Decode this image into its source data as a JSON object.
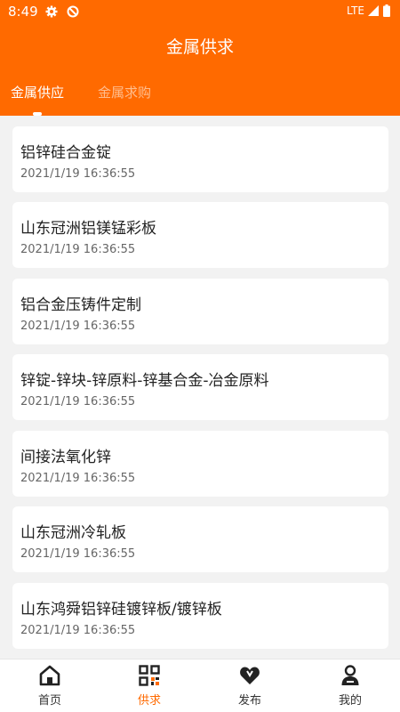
{
  "status_bar": {
    "time": "8:49",
    "network": "LTE"
  },
  "header": {
    "title": "金属供求"
  },
  "tabs": [
    {
      "label": "金属供应",
      "active": true
    },
    {
      "label": "金属求购",
      "active": false
    }
  ],
  "items": [
    {
      "title": "铝锌硅合金锭",
      "date": "2021/1/19 16:36:55"
    },
    {
      "title": "山东冠洲铝镁锰彩板",
      "date": "2021/1/19 16:36:55"
    },
    {
      "title": "铝合金压铸件定制",
      "date": "2021/1/19 16:36:55"
    },
    {
      "title": "锌锭-锌块-锌原料-锌基合金-冶金原料",
      "date": "2021/1/19 16:36:55"
    },
    {
      "title": "间接法氧化锌",
      "date": "2021/1/19 16:36:55"
    },
    {
      "title": "山东冠洲冷轧板",
      "date": "2021/1/19 16:36:55"
    },
    {
      "title": "山东鸿舜铝锌硅镀锌板/镀锌板",
      "date": "2021/1/19 16:36:55"
    }
  ],
  "bottom_nav": [
    {
      "label": "首页",
      "icon": "home-icon",
      "active": false
    },
    {
      "label": "供求",
      "icon": "qr-grid-icon",
      "active": true
    },
    {
      "label": "发布",
      "icon": "heart-icon",
      "active": false
    },
    {
      "label": "我的",
      "icon": "person-icon",
      "active": false
    }
  ],
  "colors": {
    "accent": "#ff6a00",
    "background": "#f2f2f2",
    "card": "#ffffff"
  }
}
